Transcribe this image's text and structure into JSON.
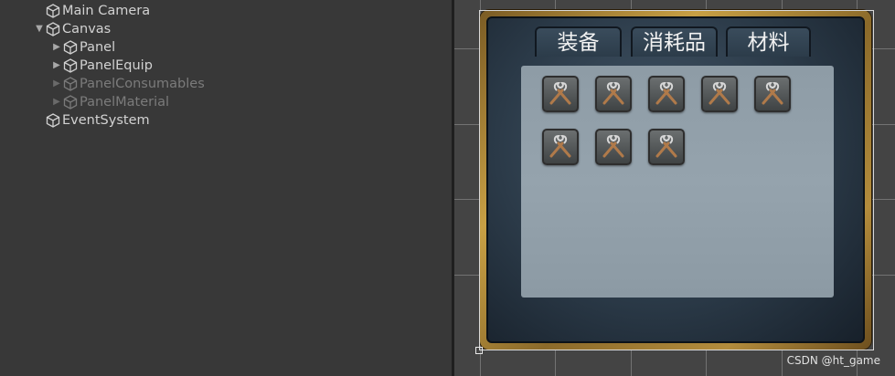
{
  "hierarchy": {
    "items": [
      {
        "label": "Main Camera",
        "expander": "",
        "dim": false
      },
      {
        "label": "Canvas",
        "expander": "▼",
        "dim": false
      },
      {
        "label": "Panel",
        "expander": "▶",
        "dim": false
      },
      {
        "label": "PanelEquip",
        "expander": "▶",
        "dim": false
      },
      {
        "label": "PanelConsumables",
        "expander": "▶",
        "dim": true
      },
      {
        "label": "PanelMaterial",
        "expander": "▶",
        "dim": true
      },
      {
        "label": "EventSystem",
        "expander": "",
        "dim": false
      }
    ],
    "icon": "gameobject-cube-icon"
  },
  "scene": {
    "tabs": [
      {
        "label": "装备"
      },
      {
        "label": "消耗品"
      },
      {
        "label": "材料"
      }
    ],
    "item_slot_count": 8,
    "item_icon": "tools-icon",
    "colors": {
      "frame_gold": "#c8a044",
      "panel_bg": "#2b3a48",
      "content_bg": "#8e9ca6"
    }
  },
  "watermark": "CSDN @ht_game"
}
